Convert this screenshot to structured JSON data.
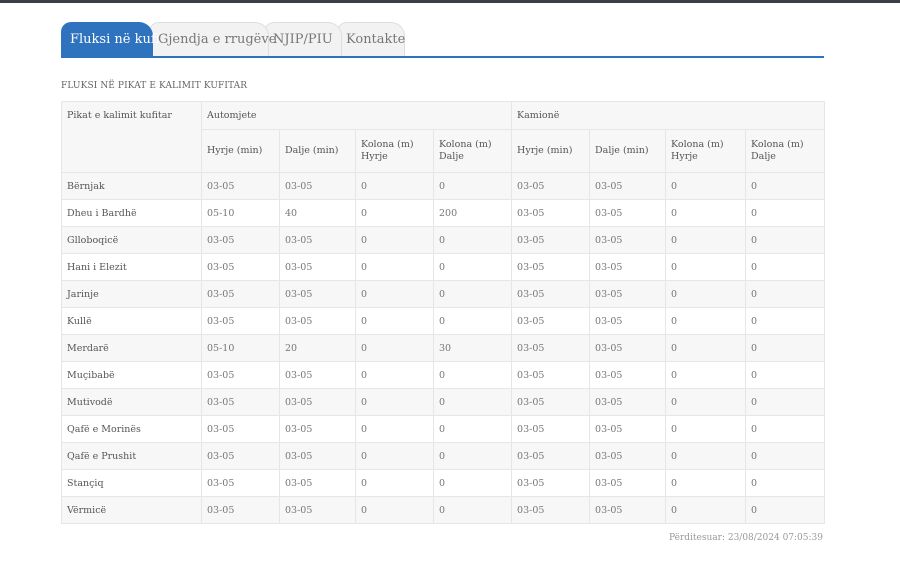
{
  "tabs": [
    {
      "label": "Fluksi në kufi",
      "active": true
    },
    {
      "label": "Gjendja e rrugëve",
      "active": false
    },
    {
      "label": "NJIP/PIU",
      "active": false
    },
    {
      "label": "Kontakte",
      "active": false
    }
  ],
  "section_title": "FLUKSI NË PIKAT E KALIMIT KUFITAR",
  "table": {
    "corner_header": "Pikat e kalimit kufitar",
    "groups": [
      "Automjete",
      "Kamionë"
    ],
    "subheaders": [
      "Hyrje (min)",
      "Dalje (min)",
      "Kolona (m) Hyrje",
      "Kolona (m) Dalje",
      "Hyrje (min)",
      "Dalje (min)",
      "Kolona (m) Hyrje",
      "Kolona (m) Dalje"
    ],
    "rows": [
      {
        "name": "Bërnjak",
        "values": [
          "03-05",
          "03-05",
          "0",
          "0",
          "03-05",
          "03-05",
          "0",
          "0"
        ]
      },
      {
        "name": "Dheu i Bardhë",
        "values": [
          "05-10",
          "40",
          "0",
          "200",
          "03-05",
          "03-05",
          "0",
          "0"
        ]
      },
      {
        "name": "Glloboqicë",
        "values": [
          "03-05",
          "03-05",
          "0",
          "0",
          "03-05",
          "03-05",
          "0",
          "0"
        ]
      },
      {
        "name": "Hani i Elezit",
        "values": [
          "03-05",
          "03-05",
          "0",
          "0",
          "03-05",
          "03-05",
          "0",
          "0"
        ]
      },
      {
        "name": "Jarinje",
        "values": [
          "03-05",
          "03-05",
          "0",
          "0",
          "03-05",
          "03-05",
          "0",
          "0"
        ]
      },
      {
        "name": "Kullë",
        "values": [
          "03-05",
          "03-05",
          "0",
          "0",
          "03-05",
          "03-05",
          "0",
          "0"
        ]
      },
      {
        "name": "Merdarë",
        "values": [
          "05-10",
          "20",
          "0",
          "30",
          "03-05",
          "03-05",
          "0",
          "0"
        ]
      },
      {
        "name": "Muçibabë",
        "values": [
          "03-05",
          "03-05",
          "0",
          "0",
          "03-05",
          "03-05",
          "0",
          "0"
        ]
      },
      {
        "name": "Mutivodë",
        "values": [
          "03-05",
          "03-05",
          "0",
          "0",
          "03-05",
          "03-05",
          "0",
          "0"
        ]
      },
      {
        "name": "Qafë e Morinës",
        "values": [
          "03-05",
          "03-05",
          "0",
          "0",
          "03-05",
          "03-05",
          "0",
          "0"
        ]
      },
      {
        "name": "Qafë e Prushit",
        "values": [
          "03-05",
          "03-05",
          "0",
          "0",
          "03-05",
          "03-05",
          "0",
          "0"
        ]
      },
      {
        "name": "Stançiq",
        "values": [
          "03-05",
          "03-05",
          "0",
          "0",
          "03-05",
          "03-05",
          "0",
          "0"
        ]
      },
      {
        "name": "Vërmicë",
        "values": [
          "03-05",
          "03-05",
          "0",
          "0",
          "03-05",
          "03-05",
          "0",
          "0"
        ]
      }
    ]
  },
  "updated": "Përditesuar: 23/08/2024 07:05:39",
  "colors": {
    "accent": "#2f73bf",
    "topbar": "#3a3f47"
  }
}
